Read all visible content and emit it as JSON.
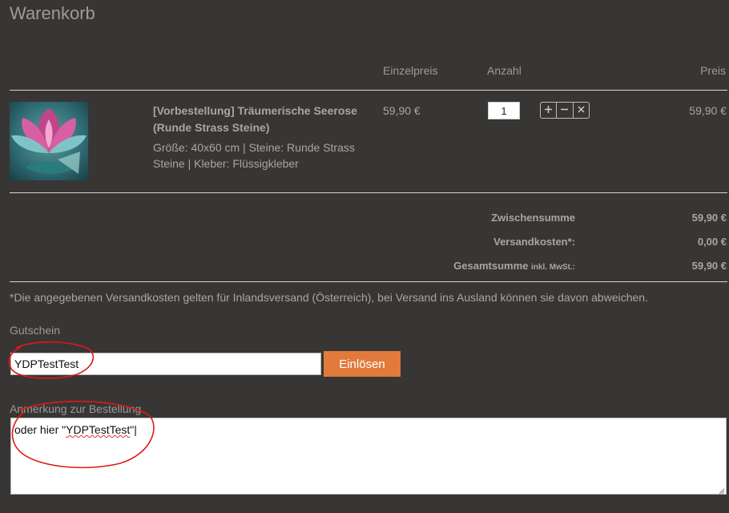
{
  "page": {
    "title": "Warenkorb"
  },
  "table": {
    "headers": {
      "unit_price": "Einzelpreis",
      "quantity": "Anzahl",
      "price": "Preis"
    }
  },
  "item": {
    "name": "[Vorbestellung] Träumerische Seerose (Runde Strass Steine)",
    "description": "Größe: 40x60 cm | Steine: Runde Strass Steine | Kleber: Flüssigkleber",
    "unit_price": "59,90 €",
    "quantity": "1",
    "price": "59,90 €"
  },
  "summary": {
    "subtotal_label": "Zwischensumme",
    "subtotal_value": "59,90 €",
    "shipping_label": "Versandkosten*:",
    "shipping_value": "0,00 €",
    "total_label": "Gesamtsumme",
    "total_suffix": "inkl. MwSt.:",
    "total_value": "59,90 €"
  },
  "shipping_note": "*Die angegebenen Versandkosten gelten für Inlandsversand (Österreich), bei Versand ins Ausland können sie davon abweichen.",
  "coupon": {
    "label": "Gutschein",
    "value": "YDPTestTest",
    "button": "Einlösen"
  },
  "remark": {
    "label": "Anmerkung zur Bestellung",
    "prefix": "oder hier \"",
    "highlighted": "YDPTestTest",
    "suffix": "\""
  },
  "icons": {
    "plus": "plus-icon",
    "minus": "minus-icon",
    "remove": "close-icon"
  },
  "colors": {
    "background": "#383634",
    "accent": "#e27a3c",
    "annotation": "#e01818"
  }
}
